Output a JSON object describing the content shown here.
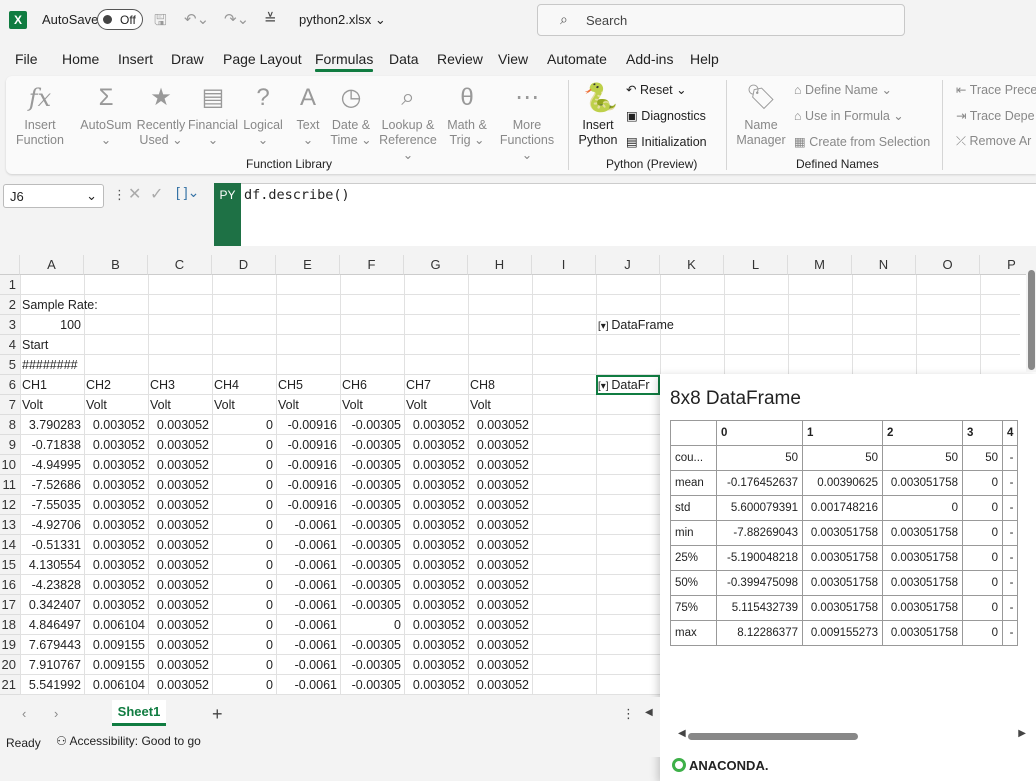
{
  "title_bar": {
    "app_icon": "X",
    "autosave_label": "AutoSave",
    "autosave_state": "Off",
    "filename": "python2.xlsx",
    "search_placeholder": "Search"
  },
  "menu_tabs": [
    "File",
    "Home",
    "Insert",
    "Draw",
    "Page Layout",
    "Formulas",
    "Data",
    "Review",
    "View",
    "Automate",
    "Add-ins",
    "Help"
  ],
  "active_tab": "Formulas",
  "ribbon": {
    "function_library": {
      "group_label": "Function Library",
      "buttons": [
        {
          "icon": "fx",
          "label1": "Insert",
          "label2": "Function"
        },
        {
          "icon": "Σ",
          "label1": "AutoSum",
          "label2": "⌄"
        },
        {
          "icon": "★",
          "label1": "Recently",
          "label2": "Used ⌄"
        },
        {
          "icon": "▤",
          "label1": "Financial",
          "label2": "⌄"
        },
        {
          "icon": "?",
          "label1": "Logical",
          "label2": "⌄"
        },
        {
          "icon": "A",
          "label1": "Text",
          "label2": "⌄"
        },
        {
          "icon": "◷",
          "label1": "Date &",
          "label2": "Time ⌄"
        },
        {
          "icon": "⌕",
          "label1": "Lookup &",
          "label2": "Reference ⌄"
        },
        {
          "icon": "θ",
          "label1": "Math &",
          "label2": "Trig ⌄"
        },
        {
          "icon": "⋯",
          "label1": "More",
          "label2": "Functions ⌄"
        }
      ]
    },
    "python": {
      "group_label": "Python (Preview)",
      "insert_label1": "Insert",
      "insert_label2": "Python",
      "reset": "Reset",
      "diagnostics": "Diagnostics",
      "initialization": "Initialization"
    },
    "defined_names": {
      "group_label": "Defined Names",
      "name_manager1": "Name",
      "name_manager2": "Manager",
      "define_name": "Define Name",
      "use_in_formula": "Use in Formula",
      "create_from_selection": "Create from Selection"
    },
    "auditing": {
      "trace_precedents": "Trace Prece",
      "trace_dependents": "Trace Depe",
      "remove_arrows": "Remove Ar"
    }
  },
  "formula_bar": {
    "name_box": "J6",
    "badge": "PY",
    "formula": "df.describe()"
  },
  "columns": [
    "A",
    "B",
    "C",
    "D",
    "E",
    "F",
    "G",
    "H",
    "I",
    "J",
    "K",
    "L",
    "M",
    "N",
    "O",
    "P"
  ],
  "rows": [
    "1",
    "2",
    "3",
    "4",
    "5",
    "6",
    "7",
    "8",
    "9",
    "10",
    "11",
    "12",
    "13",
    "14",
    "15",
    "16",
    "17",
    "18",
    "19",
    "20",
    "21"
  ],
  "cells": {
    "A2": "Sample Rate:",
    "A3": "100",
    "A4": "Start",
    "A5": "########",
    "J3": "DataFrame",
    "J6": "DataFr",
    "headers": [
      "CH1",
      "CH2",
      "CH3",
      "CH4",
      "CH5",
      "CH6",
      "CH7",
      "CH8"
    ],
    "units": [
      "Volt",
      "Volt",
      "Volt",
      "Volt",
      "Volt",
      "Volt",
      "Volt",
      "Volt"
    ],
    "data": [
      [
        "3.790283",
        "0.003052",
        "0.003052",
        "0",
        "-0.00916",
        "-0.00305",
        "0.003052",
        "0.003052"
      ],
      [
        "-0.71838",
        "0.003052",
        "0.003052",
        "0",
        "-0.00916",
        "-0.00305",
        "0.003052",
        "0.003052"
      ],
      [
        "-4.94995",
        "0.003052",
        "0.003052",
        "0",
        "-0.00916",
        "-0.00305",
        "0.003052",
        "0.003052"
      ],
      [
        "-7.52686",
        "0.003052",
        "0.003052",
        "0",
        "-0.00916",
        "-0.00305",
        "0.003052",
        "0.003052"
      ],
      [
        "-7.55035",
        "0.003052",
        "0.003052",
        "0",
        "-0.00916",
        "-0.00305",
        "0.003052",
        "0.003052"
      ],
      [
        "-4.92706",
        "0.003052",
        "0.003052",
        "0",
        "-0.0061",
        "-0.00305",
        "0.003052",
        "0.003052"
      ],
      [
        "-0.51331",
        "0.003052",
        "0.003052",
        "0",
        "-0.0061",
        "-0.00305",
        "0.003052",
        "0.003052"
      ],
      [
        "4.130554",
        "0.003052",
        "0.003052",
        "0",
        "-0.0061",
        "-0.00305",
        "0.003052",
        "0.003052"
      ],
      [
        "-4.23828",
        "0.003052",
        "0.003052",
        "0",
        "-0.0061",
        "-0.00305",
        "0.003052",
        "0.003052"
      ],
      [
        "0.342407",
        "0.003052",
        "0.003052",
        "0",
        "-0.0061",
        "-0.00305",
        "0.003052",
        "0.003052"
      ],
      [
        "4.846497",
        "0.006104",
        "0.003052",
        "0",
        "-0.0061",
        "0",
        "0.003052",
        "0.003052"
      ],
      [
        "7.679443",
        "0.009155",
        "0.003052",
        "0",
        "-0.0061",
        "-0.00305",
        "0.003052",
        "0.003052"
      ],
      [
        "7.910767",
        "0.009155",
        "0.003052",
        "0",
        "-0.0061",
        "-0.00305",
        "0.003052",
        "0.003052"
      ],
      [
        "5.541992",
        "0.006104",
        "0.003052",
        "0",
        "-0.0061",
        "-0.00305",
        "0.003052",
        "0.003052"
      ]
    ]
  },
  "dataframe_card": {
    "title": "8x8 DataFrame",
    "columns": [
      "",
      "0",
      "1",
      "2",
      "3",
      "4"
    ],
    "rows": [
      [
        "cou...",
        "50",
        "50",
        "50",
        "50",
        "-"
      ],
      [
        "mean",
        "-0.176452637",
        "0.00390625",
        "0.003051758",
        "0",
        "-"
      ],
      [
        "std",
        "5.600079391",
        "0.001748216",
        "0",
        "0",
        "-"
      ],
      [
        "min",
        "-7.88269043",
        "0.003051758",
        "0.003051758",
        "0",
        "-"
      ],
      [
        "25%",
        "-5.190048218",
        "0.003051758",
        "0.003051758",
        "0",
        "-"
      ],
      [
        "50%",
        "-0.399475098",
        "0.003051758",
        "0.003051758",
        "0",
        "-"
      ],
      [
        "75%",
        "5.115432739",
        "0.003051758",
        "0.003051758",
        "0",
        "-"
      ],
      [
        "max",
        "8.12286377",
        "0.009155273",
        "0.003051758",
        "0",
        "-"
      ]
    ],
    "brand": "ANACONDA."
  },
  "sheet_tab": "Sheet1",
  "status": {
    "ready": "Ready",
    "accessibility": "Accessibility: Good to go"
  }
}
